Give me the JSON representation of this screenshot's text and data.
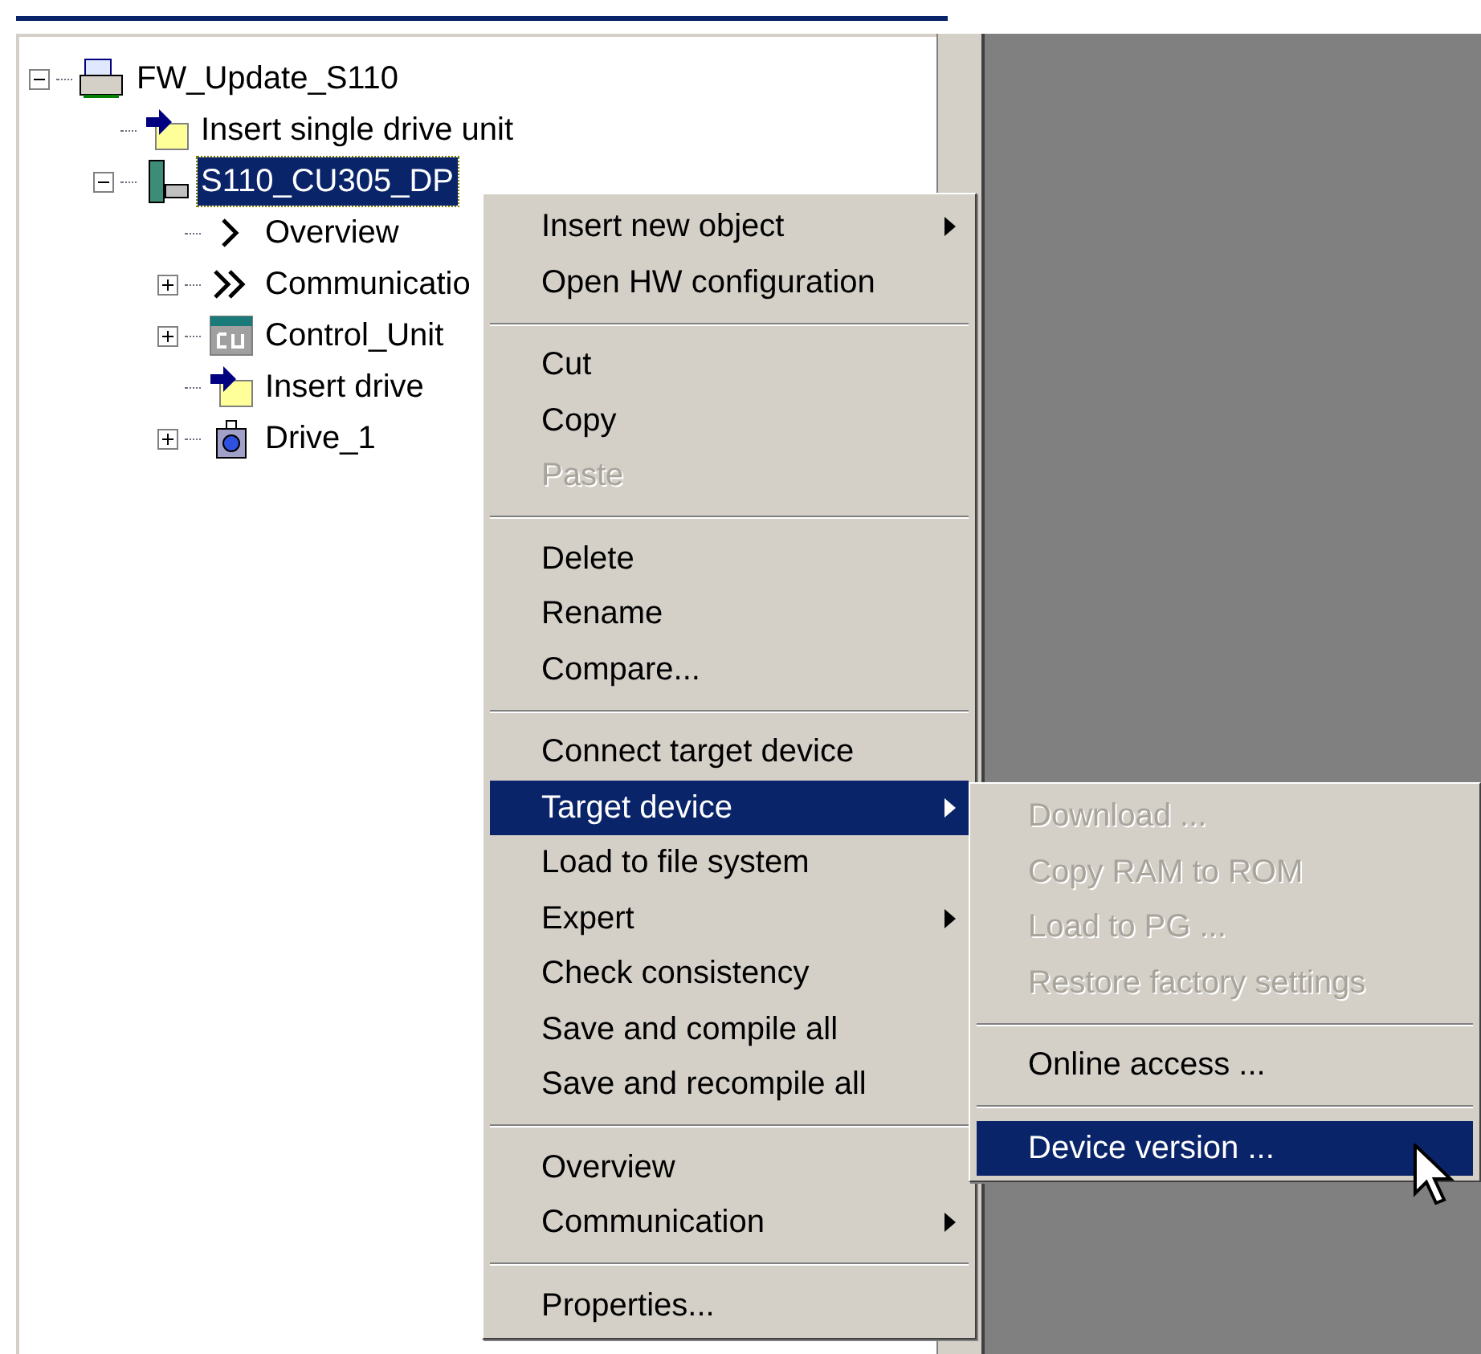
{
  "tree": [
    {
      "label": "FW_Update_S110",
      "kind": "project",
      "expanded": true,
      "selected": false,
      "children": [
        {
          "label": "Insert single drive unit",
          "kind": "insert",
          "selected": false
        },
        {
          "label": "S110_CU305_DP",
          "kind": "device",
          "expanded": true,
          "selected": true,
          "children": [
            {
              "label": "Overview",
              "kind": "chevron",
              "selected": false
            },
            {
              "label": "Communicatio",
              "kind": "double-chevron",
              "expanded": false,
              "selected": false
            },
            {
              "label": "Control_Unit",
              "kind": "cu",
              "expanded": false,
              "selected": false
            },
            {
              "label": "Insert drive",
              "kind": "insert",
              "selected": false
            },
            {
              "label": "Drive_1",
              "kind": "drive",
              "expanded": false,
              "selected": false
            }
          ]
        }
      ]
    }
  ],
  "context_menu": [
    {
      "kind": "item",
      "label": "Insert new object",
      "submenu": true,
      "disabled": false,
      "selected": false
    },
    {
      "kind": "item",
      "label": "Open HW configuration",
      "submenu": false,
      "disabled": false,
      "selected": false
    },
    {
      "kind": "separator"
    },
    {
      "kind": "item",
      "label": "Cut",
      "submenu": false,
      "disabled": false,
      "selected": false
    },
    {
      "kind": "item",
      "label": "Copy",
      "submenu": false,
      "disabled": false,
      "selected": false
    },
    {
      "kind": "item",
      "label": "Paste",
      "submenu": false,
      "disabled": true,
      "selected": false
    },
    {
      "kind": "separator"
    },
    {
      "kind": "item",
      "label": "Delete",
      "submenu": false,
      "disabled": false,
      "selected": false
    },
    {
      "kind": "item",
      "label": "Rename",
      "submenu": false,
      "disabled": false,
      "selected": false
    },
    {
      "kind": "item",
      "label": "Compare...",
      "submenu": false,
      "disabled": false,
      "selected": false
    },
    {
      "kind": "separator"
    },
    {
      "kind": "item",
      "label": "Connect target device",
      "submenu": false,
      "disabled": false,
      "selected": false
    },
    {
      "kind": "item",
      "label": "Target device",
      "submenu": true,
      "disabled": false,
      "selected": true
    },
    {
      "kind": "item",
      "label": "Load to file system",
      "submenu": false,
      "disabled": false,
      "selected": false
    },
    {
      "kind": "item",
      "label": "Expert",
      "submenu": true,
      "disabled": false,
      "selected": false
    },
    {
      "kind": "item",
      "label": "Check consistency",
      "submenu": false,
      "disabled": false,
      "selected": false
    },
    {
      "kind": "item",
      "label": "Save and compile all",
      "submenu": false,
      "disabled": false,
      "selected": false
    },
    {
      "kind": "item",
      "label": "Save and recompile all",
      "submenu": false,
      "disabled": false,
      "selected": false
    },
    {
      "kind": "separator"
    },
    {
      "kind": "item",
      "label": "Overview",
      "submenu": false,
      "disabled": false,
      "selected": false
    },
    {
      "kind": "item",
      "label": "Communication",
      "submenu": true,
      "disabled": false,
      "selected": false
    },
    {
      "kind": "separator"
    },
    {
      "kind": "item",
      "label": "Properties...",
      "submenu": false,
      "disabled": false,
      "selected": false
    }
  ],
  "submenu": [
    {
      "kind": "item",
      "label": "Download ...",
      "submenu": false,
      "disabled": true,
      "selected": false
    },
    {
      "kind": "item",
      "label": "Copy RAM to ROM",
      "submenu": false,
      "disabled": true,
      "selected": false
    },
    {
      "kind": "item",
      "label": "Load to PG ...",
      "submenu": false,
      "disabled": true,
      "selected": false
    },
    {
      "kind": "item",
      "label": "Restore factory settings",
      "submenu": false,
      "disabled": true,
      "selected": false
    },
    {
      "kind": "separator"
    },
    {
      "kind": "item",
      "label": "Online access ...",
      "submenu": false,
      "disabled": false,
      "selected": false
    },
    {
      "kind": "separator"
    },
    {
      "kind": "item",
      "label": "Device version ...",
      "submenu": false,
      "disabled": false,
      "selected": true
    }
  ]
}
